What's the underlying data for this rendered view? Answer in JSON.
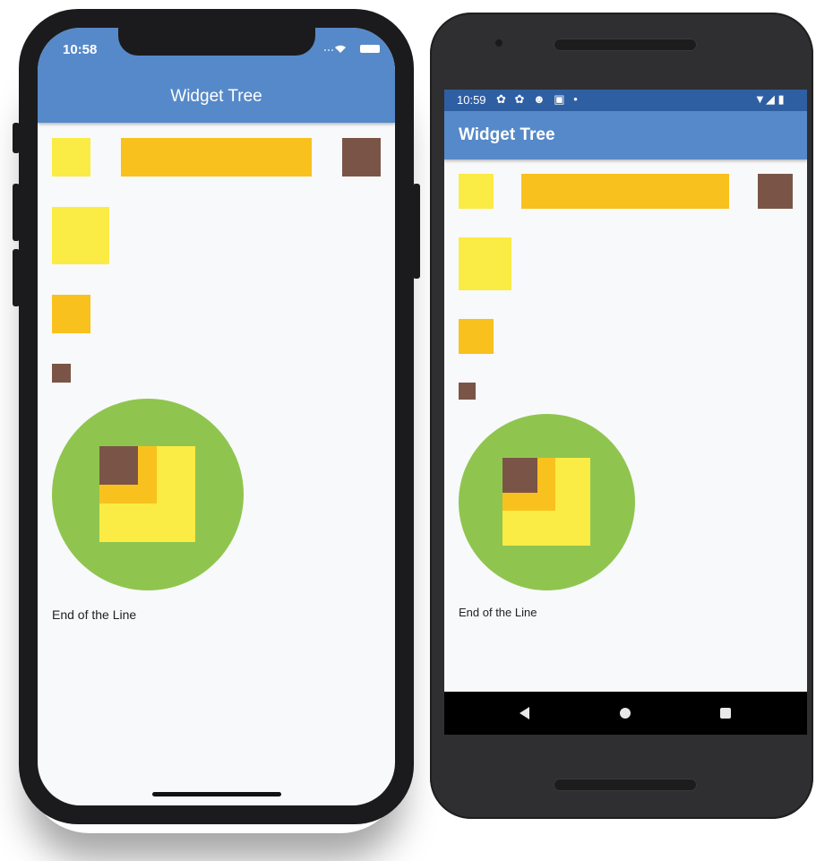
{
  "colors": {
    "appbar": "#5689c9",
    "android_statusbar": "#2f5fa3",
    "yellow": "#fbeb45",
    "amber": "#f9c11e",
    "brown": "#7a5547",
    "green": "#8fc54f",
    "background": "#f8f9fa"
  },
  "ios": {
    "status_time": "10:58",
    "status_icons": "wifi-icon battery-icon",
    "app_title": "Widget Tree",
    "footer_text": "End of the Line"
  },
  "android": {
    "status_time": "10:59",
    "status_icons_text": "✿ ✿ ☻ ▣ •",
    "status_right_text": "▼◢ ▮",
    "app_title": "Widget Tree",
    "footer_text": "End of the Line",
    "nav": [
      "back-icon",
      "home-icon",
      "recents-icon"
    ]
  }
}
